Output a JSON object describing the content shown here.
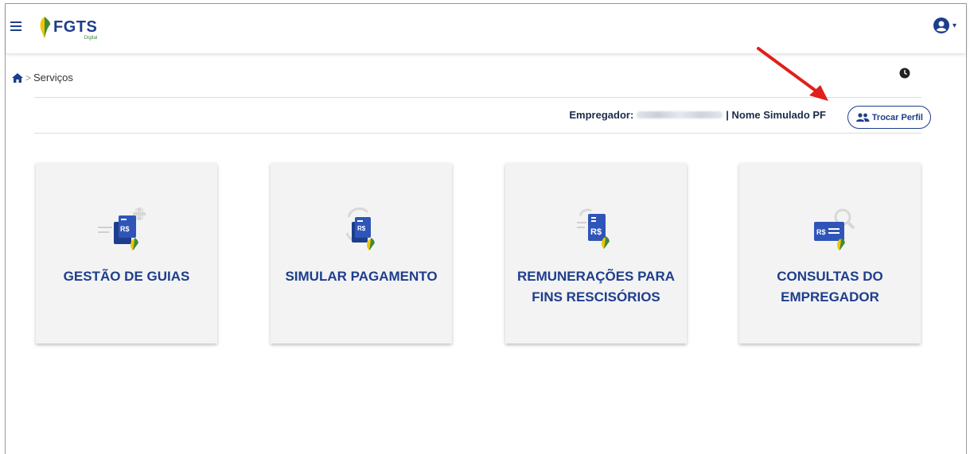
{
  "header": {
    "logo_text": "FGTS",
    "logo_subtext": "Digital",
    "menu_icon": "hamburger-icon",
    "user_icon": "user-circle-icon"
  },
  "breadcrumb": {
    "home_icon": "home-icon",
    "current": "Serviços"
  },
  "history_icon": "clock-icon",
  "employer": {
    "label": "Empregador:",
    "separator_name": "| Nome Simulado PF"
  },
  "switch_profile": {
    "label": "Trocar Perfil",
    "icon": "users-icon"
  },
  "cards": [
    {
      "label": "GESTÃO DE GUIAS",
      "icon": "document-plus-icon"
    },
    {
      "label": "SIMULAR PAGAMENTO",
      "icon": "document-refresh-icon"
    },
    {
      "label": "REMUNERAÇÕES PARA FINS RESCISÓRIOS",
      "icon": "document-money-icon"
    },
    {
      "label": "CONSULTAS DO EMPREGADOR",
      "icon": "card-search-icon"
    }
  ],
  "colors": {
    "brand_blue": "#1d3e8c",
    "brand_green": "#3d8b3d",
    "brand_yellow": "#f2c500",
    "annotation_red": "#e0201b"
  }
}
